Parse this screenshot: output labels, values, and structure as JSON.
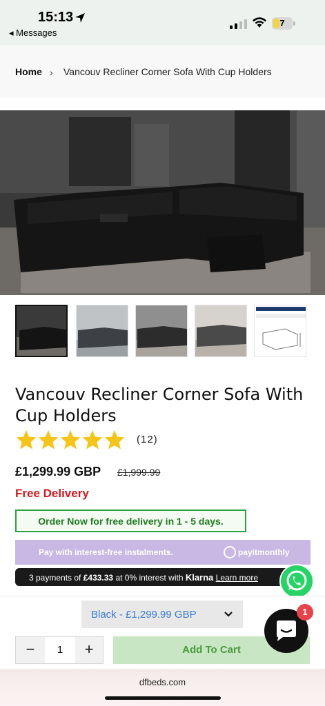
{
  "status_bar": {
    "time": "15:13",
    "back_label": "◂ Messages",
    "battery": "7"
  },
  "breadcrumb": {
    "home": "Home",
    "separator": "›",
    "current": "Vancouv Recliner Corner Sofa With Cup Holders"
  },
  "product": {
    "title": "Vancouv Recliner Corner Sofa With Cup Holders",
    "rating": 5,
    "review_count": "(12)",
    "price": "£1,299.99 GBP",
    "compare_price": "£1,999.99",
    "free_delivery": "Free Delivery",
    "order_banner": "Order Now for free delivery in 1 - 5 days."
  },
  "payitmonthly": {
    "text": "Pay with interest-free instalments.",
    "logo": "payitmonthly"
  },
  "klarna": {
    "prefix": "3 payments of ",
    "amount": "£433.33",
    "middle": " at 0% interest with ",
    "brand": "Klarna",
    "learn_more": "Learn more"
  },
  "purchase": {
    "variant": "Black - £1,299.99 GBP",
    "quantity": "1",
    "minus": "−",
    "plus": "+",
    "add_to_cart": "Add To Cart"
  },
  "chat": {
    "badge": "1"
  },
  "browser": {
    "url": "dfbeds.com"
  },
  "colors": {
    "accent_red": "#d71920",
    "order_green": "#2ea044",
    "payitmonthly_purple": "#c8b8e3",
    "whatsapp_green": "#25d366",
    "add_to_cart_bg": "#c8e6c3",
    "star_yellow": "#f5c518"
  },
  "icons": [
    "location-arrow-icon",
    "signal-icon",
    "wifi-icon",
    "battery-icon",
    "chevron-right-icon",
    "star-icon",
    "whatsapp-icon",
    "chevron-down-icon",
    "minus-icon",
    "plus-icon",
    "chat-icon"
  ]
}
